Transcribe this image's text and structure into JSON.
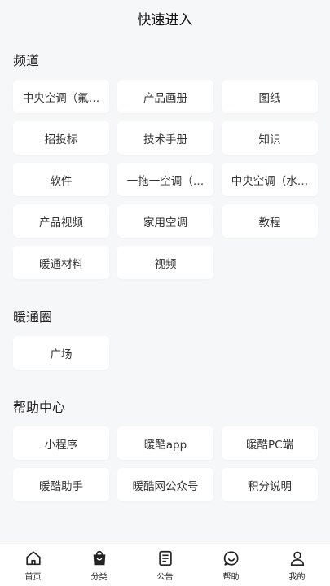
{
  "header": {
    "title": "快速进入"
  },
  "sections": [
    {
      "title": "频道",
      "items": [
        "中央空调（氟…",
        "产品画册",
        "图纸",
        "招投标",
        "技术手册",
        "知识",
        "软件",
        "一拖一空调（…",
        "中央空调（水…",
        "产品视频",
        "家用空调",
        "教程",
        "暖通材料",
        "视频"
      ]
    },
    {
      "title": "暖通圈",
      "items": [
        "广场"
      ]
    },
    {
      "title": "帮助中心",
      "items": [
        "小程序",
        "暖酷app",
        "暖酷PC端",
        "暖酷助手",
        "暖酷网公众号",
        "积分说明"
      ]
    }
  ],
  "tabbar": {
    "items": [
      {
        "label": "首页",
        "icon": "home-icon",
        "active": false
      },
      {
        "label": "分类",
        "icon": "bag-icon",
        "active": true
      },
      {
        "label": "公告",
        "icon": "document-icon",
        "active": false
      },
      {
        "label": "帮助",
        "icon": "chat-bubble-icon",
        "active": false
      },
      {
        "label": "我的",
        "icon": "user-icon",
        "active": false
      }
    ]
  },
  "colors": {
    "background": "#f6f7f9",
    "card": "#ffffff",
    "text": "#222222"
  }
}
